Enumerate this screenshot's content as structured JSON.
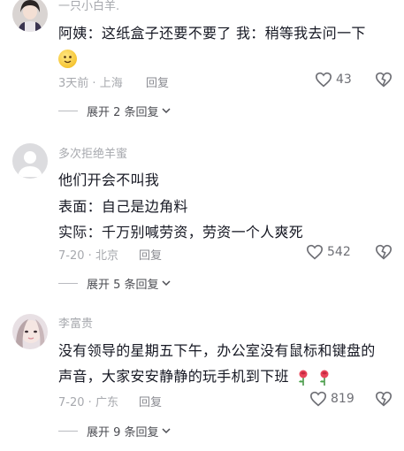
{
  "comments": [
    {
      "username": "一只小白羊.",
      "lines": [
        "阿姨：这纸盒子还要不要了 我：稍等我去问一下"
      ],
      "time": "3天前",
      "location": "上海",
      "reply_label": "回复",
      "likes": "43",
      "expand_label": "展开 2 条回复",
      "avatar_icon": "girl-avatar-icon"
    },
    {
      "username": "多次拒绝羊蜜",
      "lines": [
        "他们开会不叫我",
        "表面：自己是边角料",
        "实际：千万别喊劳资，劳资一个人爽死"
      ],
      "time": "7-20",
      "location": "北京",
      "reply_label": "回复",
      "likes": "542",
      "expand_label": "展开 5 条回复",
      "avatar_icon": "default-user-avatar-icon"
    },
    {
      "username": "李富贵",
      "lines": [
        "没有领导的星期五下午，办公室没有鼠标和键盘的",
        "声音，大家安安静静的玩手机到下班"
      ],
      "time": "7-20",
      "location": "广东",
      "reply_label": "回复",
      "likes": "819",
      "expand_label": "展开 9 条回复",
      "avatar_icon": "girl-avatar-icon"
    }
  ],
  "icons": {
    "like": "heart-outline-icon",
    "dislike": "broken-heart-icon",
    "chevron": "chevron-down-icon",
    "emoji": "emoji-face-icon",
    "rose": "rose-emoji-icon"
  },
  "colors": {
    "text_primary": "#161823",
    "text_secondary": "#a7a9ae",
    "icon": "#6e6f75"
  }
}
